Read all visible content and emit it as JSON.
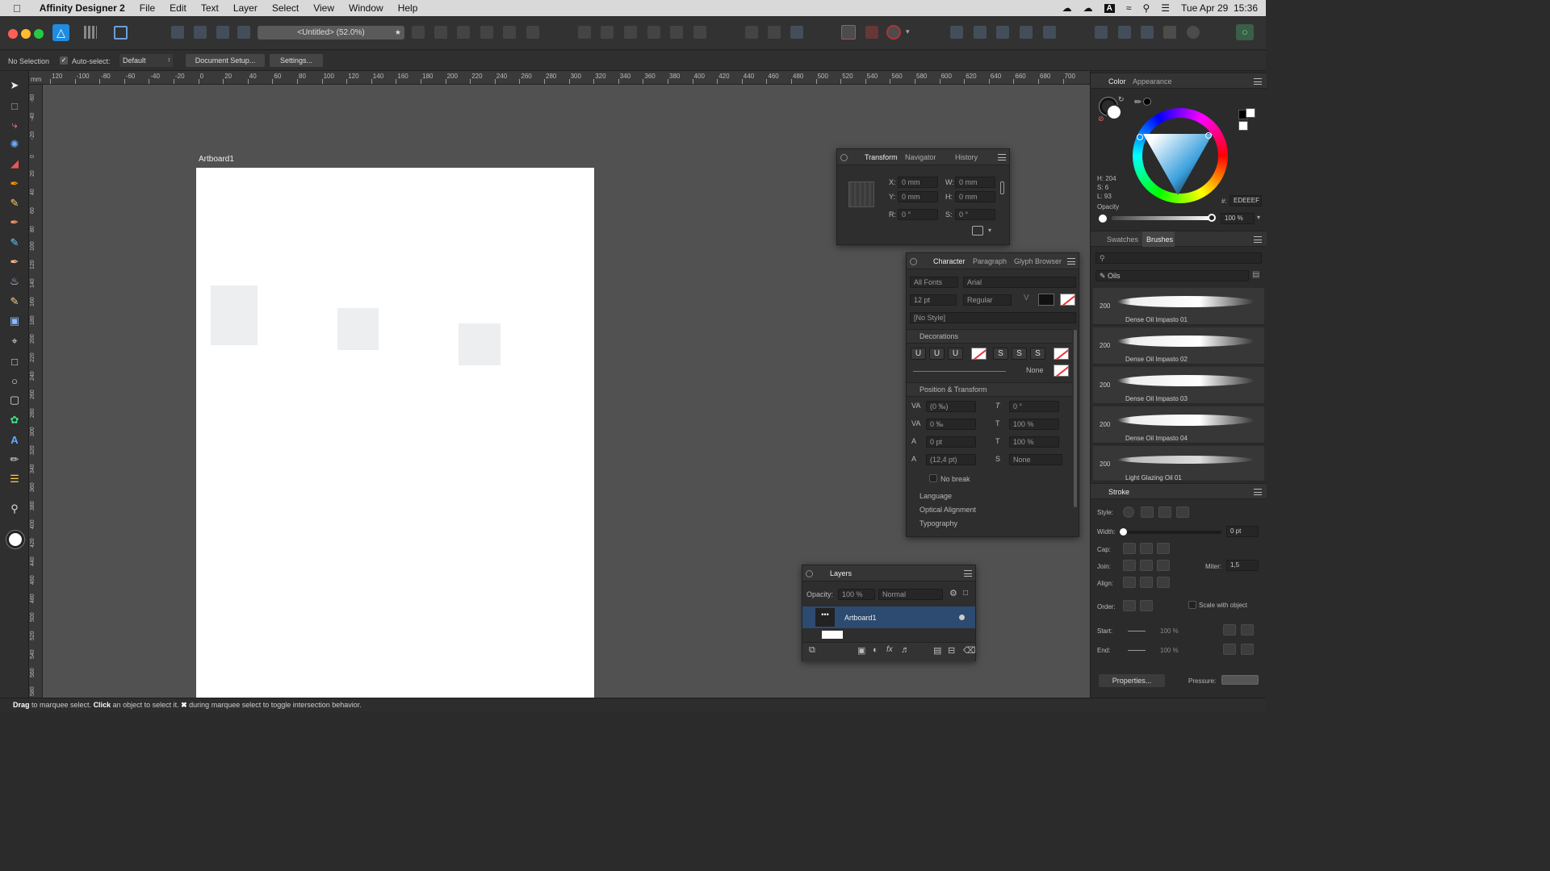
{
  "menubar": {
    "app_name": "Affinity Designer 2",
    "items": [
      "File",
      "Edit",
      "Text",
      "Layer",
      "Select",
      "View",
      "Window",
      "Help"
    ],
    "datetime": "Tue Apr 29  15:36"
  },
  "toolbar": {
    "doc_title": "<Untitled> (52.0%)",
    "doc_modified_mark": "★"
  },
  "context": {
    "selection": "No Selection",
    "auto_select_label": "Auto-select:",
    "auto_select_value": "Default",
    "document_setup": "Document Setup...",
    "settings": "Settings..."
  },
  "ruler": {
    "unit": "mm",
    "top_ticks": [
      "120",
      "-100",
      "-80",
      "-60",
      "-40",
      "-20",
      "0",
      "20",
      "40",
      "60",
      "80",
      "100",
      "120",
      "140",
      "160",
      "180",
      "200",
      "220",
      "240",
      "260",
      "280",
      "300",
      "320",
      "340",
      "360",
      "380",
      "400",
      "420",
      "440",
      "460",
      "480",
      "500",
      "520",
      "540",
      "560",
      "580",
      "600",
      "620",
      "640",
      "660",
      "680",
      "700"
    ],
    "left_ticks": [
      "-60",
      "-40",
      "-20",
      "0",
      "20",
      "40",
      "60",
      "80",
      "100",
      "120",
      "140",
      "160",
      "180",
      "200",
      "220",
      "240",
      "260",
      "280",
      "300",
      "320",
      "340",
      "360",
      "380",
      "400",
      "420",
      "440",
      "460",
      "480",
      "500",
      "520",
      "540",
      "560",
      "580",
      "600",
      "620"
    ]
  },
  "canvas": {
    "artboard_label": "Artboard1",
    "shape_fill": "#EDEEEF",
    "page_bg": "#515151",
    "artboard_bg": "#FFFFFF"
  },
  "transform_panel": {
    "tabs": [
      "Transform",
      "Navigator",
      "History"
    ],
    "x_label": "X:",
    "x_value": "0 mm",
    "y_label": "Y:",
    "y_value": "0 mm",
    "w_label": "W:",
    "w_value": "0 mm",
    "h_label": "H:",
    "h_value": "0 mm",
    "r_label": "R:",
    "r_value": "0 °",
    "s_label": "S:",
    "s_value": "0 °"
  },
  "character_panel": {
    "tabs": [
      "Character",
      "Paragraph",
      "Glyph Browser"
    ],
    "font_collection": "All Fonts",
    "font_family": "Arial",
    "font_size": "12 pt",
    "font_style": "Regular",
    "style": "[No Style]",
    "decorations_header": "Decorations",
    "deco_buttons": [
      "U",
      "U",
      "U",
      "S",
      "S",
      "S"
    ],
    "deco_none": "None",
    "position_header": "Position & Transform",
    "tracking": "(0 ‰)",
    "kerning": "0 ‰",
    "baseline": "0 pt",
    "leading": "(12,4 pt)",
    "skew": "0 °",
    "hscale": "100 %",
    "vscale": "100 %",
    "superscript": "None",
    "no_break": "No break",
    "sections": [
      "Language",
      "Optical Alignment",
      "Typography"
    ]
  },
  "layers_panel": {
    "title": "Layers",
    "opacity_label": "Opacity:",
    "opacity_value": "100 %",
    "blend": "Normal",
    "layer_name": "Artboard1",
    "layer_dots": "•••"
  },
  "color_panel": {
    "tabs": [
      "Color",
      "Appearance"
    ],
    "h": "H: 204",
    "s": "S: 6",
    "l": "L: 93",
    "hex_label": "#:",
    "hex": "EDEEEF",
    "opacity_label": "Opacity",
    "opacity_value": "100 %"
  },
  "brushes_panel": {
    "tabs": [
      "Swatches",
      "Brushes"
    ],
    "category": "Oils",
    "brushes": [
      {
        "size": "200",
        "name": "Dense Oil Impasto 01"
      },
      {
        "size": "200",
        "name": "Dense Oil Impasto 02"
      },
      {
        "size": "200",
        "name": "Dense Oil Impasto 03"
      },
      {
        "size": "200",
        "name": "Dense Oil Impasto 04"
      },
      {
        "size": "200",
        "name": "Light Glazing Oil 01"
      }
    ]
  },
  "stroke_panel": {
    "title": "Stroke",
    "style_label": "Style:",
    "width_label": "Width:",
    "width_value": "0 pt",
    "cap_label": "Cap:",
    "join_label": "Join:",
    "miter_label": "Miter:",
    "miter_value": "1,5",
    "align_label": "Align:",
    "order_label": "Order:",
    "scale_label": "Scale with object",
    "start_label": "Start:",
    "start_value": "100 %",
    "end_label": "End:",
    "end_value": "100 %",
    "properties": "Properties...",
    "pressure_label": "Pressure:"
  },
  "status": {
    "drag": "Drag",
    "t1": " to marquee select. ",
    "click": "Click",
    "t2": " an object to select it. ",
    "key": "✖",
    "t3": " during marquee select to toggle intersection behavior."
  }
}
